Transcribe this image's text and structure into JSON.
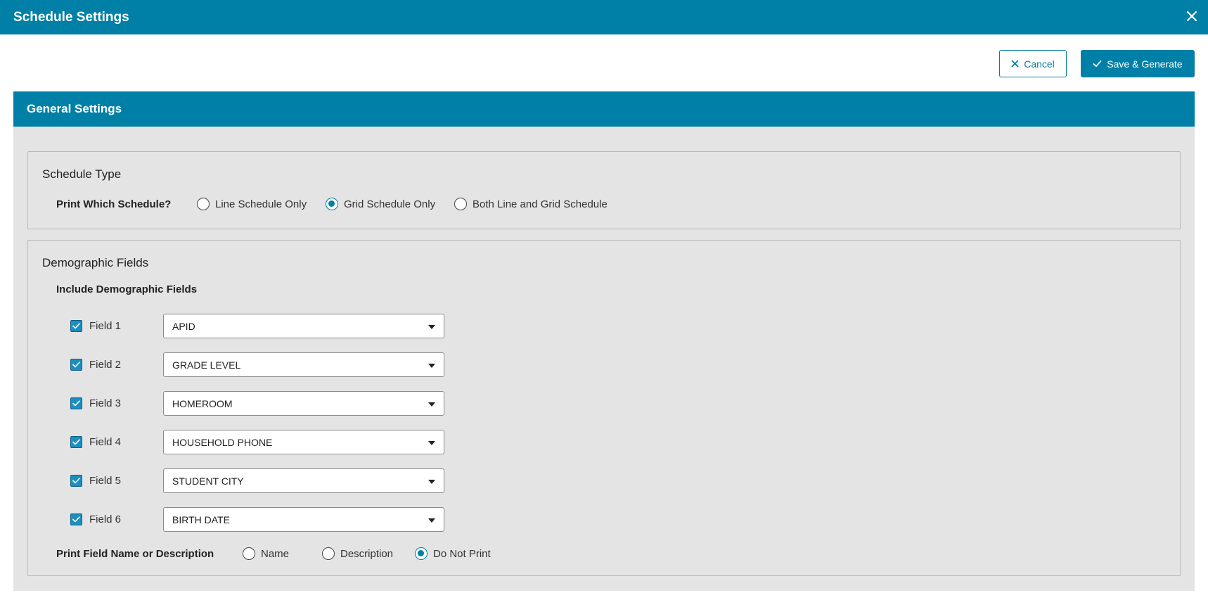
{
  "header": {
    "title": "Schedule Settings",
    "close_icon": "close-icon"
  },
  "toolbar": {
    "cancel_label": "Cancel",
    "save_label": "Save & Generate"
  },
  "panel": {
    "title": "General Settings"
  },
  "schedule_type": {
    "legend": "Schedule Type",
    "question": "Print Which Schedule?",
    "options": [
      {
        "label": "Line Schedule Only",
        "selected": false
      },
      {
        "label": "Grid Schedule Only",
        "selected": true
      },
      {
        "label": "Both Line and Grid Schedule",
        "selected": false
      }
    ]
  },
  "demographic": {
    "legend": "Demographic Fields",
    "include_label": "Include Demographic Fields",
    "fields": [
      {
        "label": "Field 1",
        "checked": true,
        "value": "APID"
      },
      {
        "label": "Field 2",
        "checked": true,
        "value": "GRADE LEVEL"
      },
      {
        "label": "Field 3",
        "checked": true,
        "value": "HOMEROOM"
      },
      {
        "label": "Field 4",
        "checked": true,
        "value": "HOUSEHOLD PHONE"
      },
      {
        "label": "Field 5",
        "checked": true,
        "value": "STUDENT CITY"
      },
      {
        "label": "Field 6",
        "checked": true,
        "value": "BIRTH DATE"
      }
    ],
    "print_label": "Print Field Name or Description",
    "print_options": [
      {
        "label": "Name",
        "selected": false
      },
      {
        "label": "Description",
        "selected": false
      },
      {
        "label": "Do Not Print",
        "selected": true
      }
    ]
  },
  "colors": {
    "accent": "#0080a6",
    "panel_bg": "#e4e4e4",
    "checkbox": "#1a8fc2"
  }
}
